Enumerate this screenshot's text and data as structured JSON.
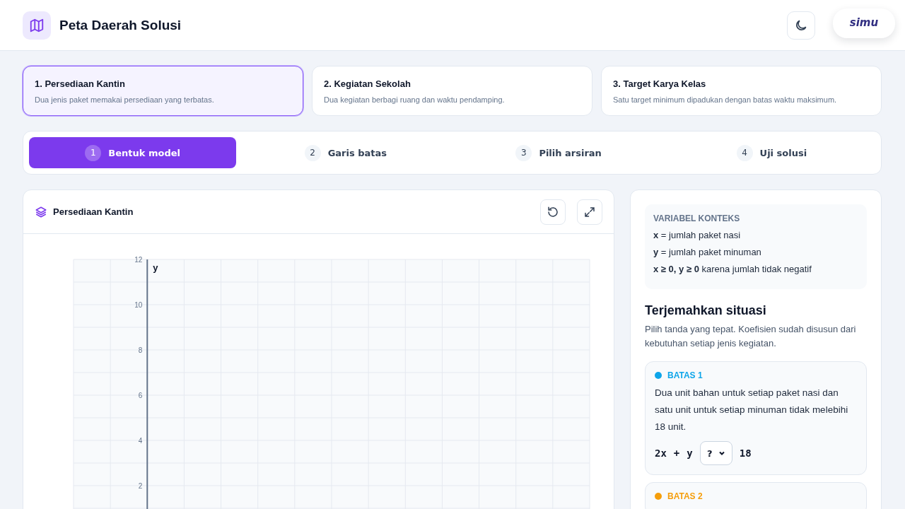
{
  "header": {
    "title": "Peta Daerah Solusi",
    "logo_text": "simu"
  },
  "scenarios": [
    {
      "title": "1. Persediaan Kantin",
      "description": "Dua jenis paket memakai persediaan yang terbatas.",
      "selected": true
    },
    {
      "title": "2. Kegiatan Sekolah",
      "description": "Dua kegiatan berbagi ruang dan waktu pendamping.",
      "selected": false
    },
    {
      "title": "3. Target Karya Kelas",
      "description": "Satu target minimum dipadukan dengan batas waktu maksimum.",
      "selected": false
    }
  ],
  "steps": [
    {
      "number": "1",
      "label": "Bentuk model",
      "selected": true
    },
    {
      "number": "2",
      "label": "Garis batas",
      "selected": false
    },
    {
      "number": "3",
      "label": "Pilih arsiran",
      "selected": false
    },
    {
      "number": "4",
      "label": "Uji solusi",
      "selected": false
    }
  ],
  "graph_panel": {
    "title": "Persediaan Kantin",
    "graph": {
      "y_axis_label": "y",
      "y_tick_labels": [
        "12",
        "10",
        "8",
        "6",
        "4",
        "2"
      ]
    }
  },
  "side_panel": {
    "context": {
      "heading": "VARIABEL KONTEKS",
      "lines": [
        "**x** = jumlah paket nasi",
        "**y** = jumlah paket minuman",
        "**x ≥ 0, y ≥ 0** karena jumlah tidak negatif"
      ]
    },
    "heading": "Terjemahkan situasi",
    "description": "Pilih tanda yang tepat. Koefisien sudah disusun dari kebutuhan setiap jenis kegiatan.",
    "constraints": [
      {
        "label": "BATAS 1",
        "color": "#0ea5e9",
        "text": "Dua unit bahan untuk setiap paket nasi dan satu unit untuk setiap minuman tidak melebihi 18 unit.",
        "terms": [
          "2x",
          "+",
          "y"
        ],
        "sign": "?",
        "rhs": "18"
      },
      {
        "label": "BATAS 2",
        "color": "#f59e0b"
      }
    ]
  }
}
